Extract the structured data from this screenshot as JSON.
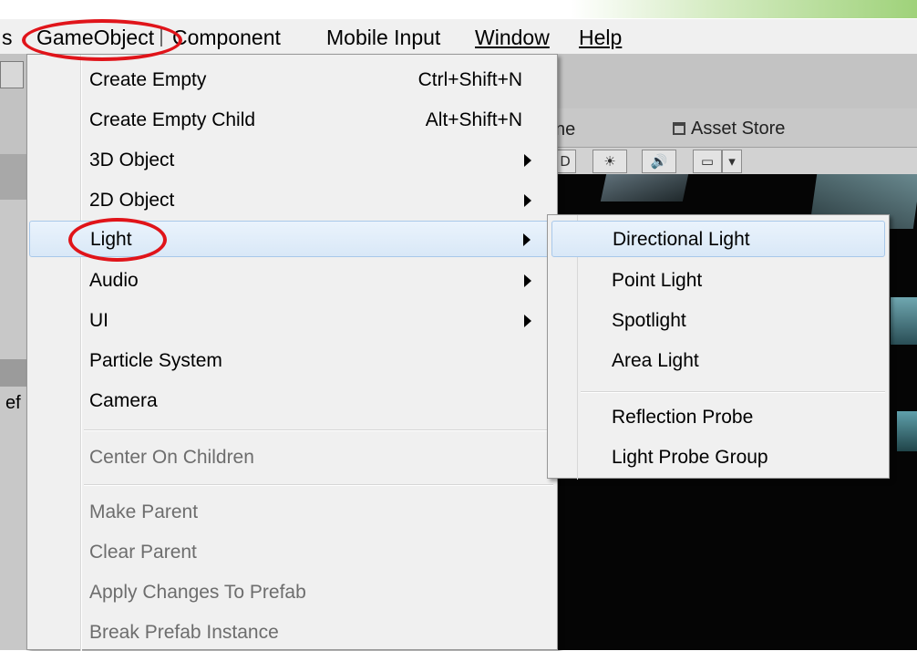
{
  "menubar": {
    "partial_left": "s",
    "items": [
      "GameObject",
      "Component",
      "Mobile Input",
      "Window",
      "Help"
    ]
  },
  "left_strip": {
    "partial_text": "ef"
  },
  "editor": {
    "partial_tab": "ne",
    "asset_store_tab": "Asset Store",
    "toolbar": {
      "partial": "D",
      "sun": "☀",
      "audio": "🔊",
      "image": "▭",
      "dropdown": "▾"
    }
  },
  "gameobject_menu": {
    "items": [
      {
        "label": "Create Empty",
        "shortcut": "Ctrl+Shift+N"
      },
      {
        "label": "Create Empty Child",
        "shortcut": "Alt+Shift+N"
      },
      {
        "label": "3D Object"
      },
      {
        "label": "2D Object"
      },
      {
        "label": "Light"
      },
      {
        "label": "Audio"
      },
      {
        "label": "UI"
      },
      {
        "label": "Particle System"
      },
      {
        "label": "Camera"
      },
      {
        "label": "Center On Children"
      },
      {
        "label": "Make Parent"
      },
      {
        "label": "Clear Parent"
      },
      {
        "label": "Apply Changes To Prefab"
      },
      {
        "label": "Break Prefab Instance"
      }
    ]
  },
  "light_submenu": {
    "items": [
      {
        "label": "Directional Light"
      },
      {
        "label": "Point Light"
      },
      {
        "label": "Spotlight"
      },
      {
        "label": "Area Light"
      },
      {
        "label": "Reflection Probe"
      },
      {
        "label": "Light Probe Group"
      }
    ]
  },
  "colors": {
    "annotation_red": "#e0141a",
    "menu_background": "#f0f0f0",
    "highlight_border": "#a8c8ea",
    "disabled_text": "#6d6d6d"
  }
}
